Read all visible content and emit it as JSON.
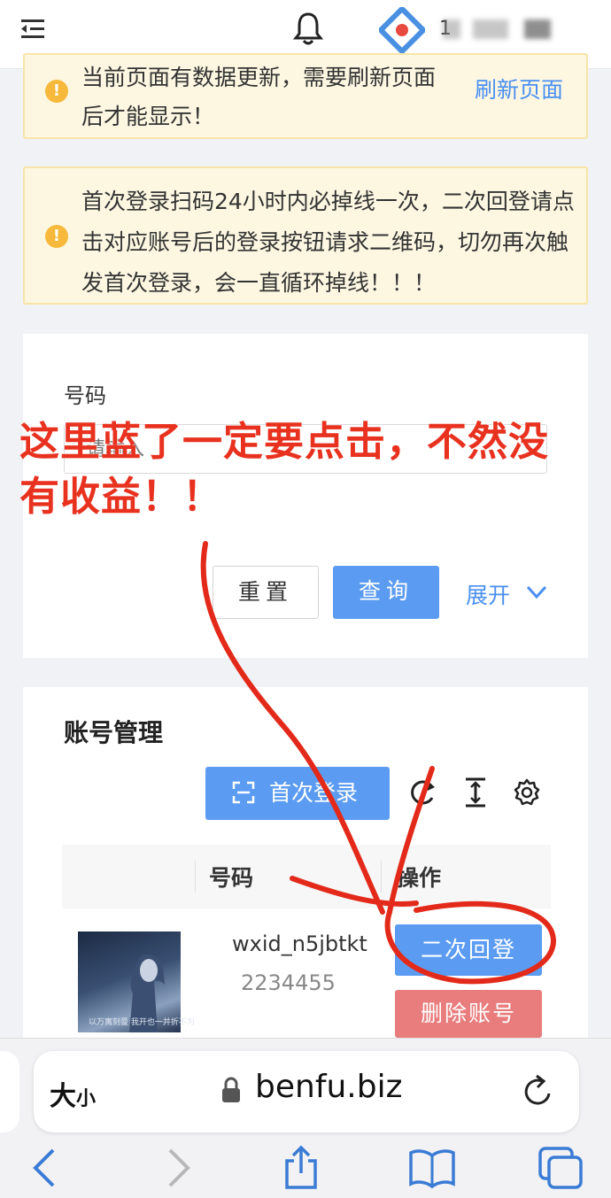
{
  "header": {
    "user_name": "1"
  },
  "alerts": [
    {
      "text": "当前页面有数据更新，需要刷新页面后才能显示！",
      "link": "刷新页面"
    },
    {
      "text": "首次登录扫码24小时内必掉线一次，二次回登请点击对应账号后的登录按钮请求二维码，切勿再次触发首次登录，会一直循环掉线！！！"
    }
  ],
  "search": {
    "label": "号码",
    "placeholder": "请输入",
    "reset": "重置",
    "query": "查询",
    "expand": "展开"
  },
  "accounts": {
    "title": "账号管理",
    "first_login": "首次登录",
    "columns": [
      "号码",
      "操作"
    ],
    "rows": [
      {
        "thumb_caption": "以万寓刻曼  我开也一并折不为",
        "wxid": "wxid_n5jbtkt",
        "phone": "2234455",
        "relogin": "二次回登",
        "delete": "删除账号"
      }
    ]
  },
  "annotation": "这里蓝了一定要点击，不然没有收益！！",
  "browser": {
    "text_size": "大",
    "text_size_small": "小",
    "url": "benfu.biz"
  },
  "colors": {
    "primary": "#5b9cf2",
    "danger": "#e97c7c",
    "warning_bg": "#fdf7e2",
    "annotation": "#e8321f"
  }
}
